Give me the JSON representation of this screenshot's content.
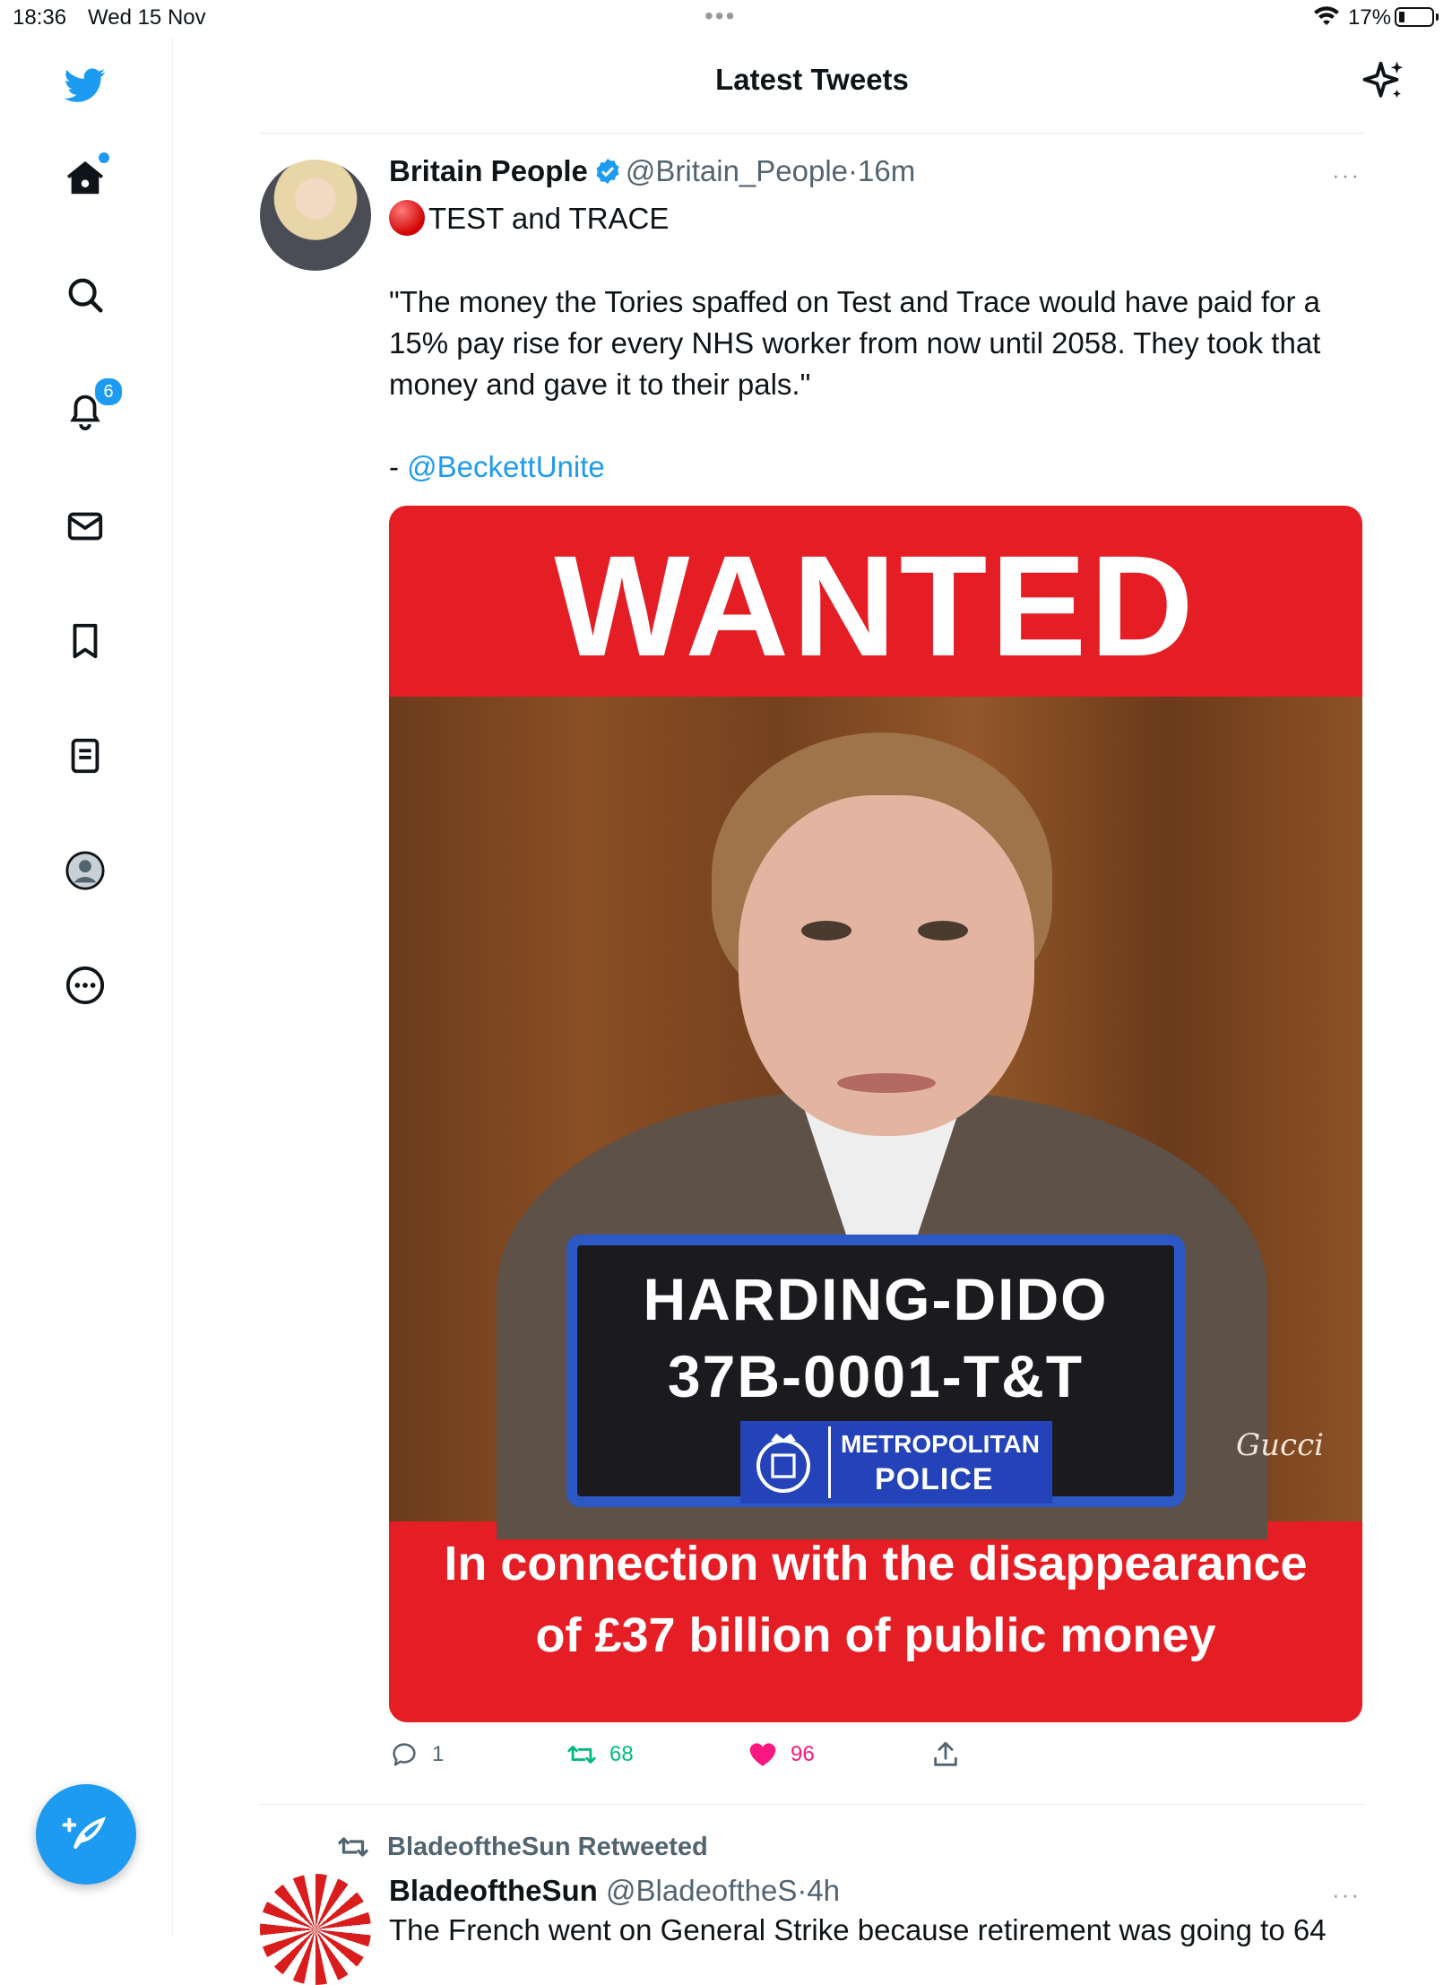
{
  "status_bar": {
    "time": "18:36",
    "date": "Wed 15 Nov",
    "dots": "•••",
    "battery": "17%"
  },
  "header": {
    "title": "Latest Tweets"
  },
  "sidebar": {
    "notifications_count": "6"
  },
  "tweets": [
    {
      "name": "Britain People",
      "handle": "@Britain_People",
      "separator": "·",
      "time": "16m",
      "more": "···",
      "line1": "TEST and TRACE",
      "body": "\"The money the Tories spaffed on Test and Trace would have paid for a 15% pay rise for every NHS worker from now until 2058.  They took that money and gave it to their pals.\"",
      "attribution_prefix": "- ",
      "attribution_link": "@BeckettUnite",
      "media": {
        "headline": "WANTED",
        "plate_name": "HARDING-DIDO",
        "plate_code": "37B-0001-T&T",
        "police_line1": "METROPOLITAN",
        "police_line2": "POLICE",
        "signature": "Gucci",
        "caption_line1": "In connection with the disappearance",
        "caption_line2": "of £37 billion of public money"
      },
      "stats": {
        "replies": "1",
        "retweets": "68",
        "likes": "96"
      }
    },
    {
      "retweeted_by": "BladeoftheSun Retweeted",
      "name": "BladeoftheSun",
      "handle": "@BladeoftheS",
      "separator": "·",
      "time": "4h",
      "more": "···",
      "text": "The French went on General Strike because retirement was going to 64"
    }
  ],
  "colors": {
    "accent": "#1d9bf0",
    "retweet": "#00ba7c",
    "like": "#f91880",
    "poster_red": "#e51e25",
    "police_blue": "#2443b8"
  }
}
